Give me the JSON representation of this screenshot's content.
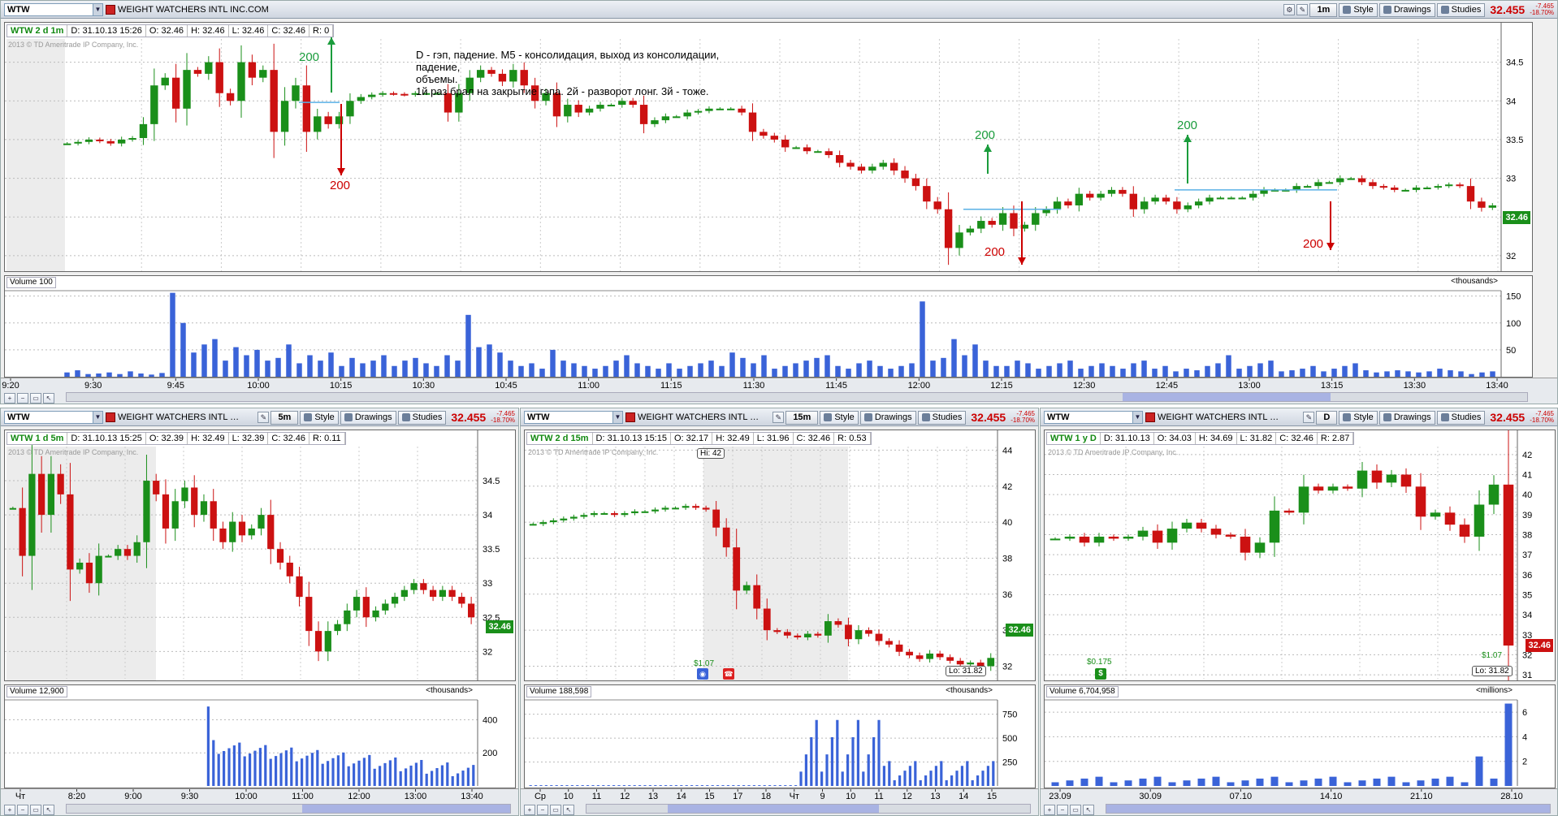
{
  "colors": {
    "up": "#1a8f1a",
    "down": "#cc1111",
    "volume": "#3a63d8",
    "price_tag": "#1a8f1a",
    "last": "#cc0000",
    "ann_green": "#1a9c3c",
    "ann_red": "#cc0000",
    "level_line": "#5ab0e6"
  },
  "top": {
    "symbol": "WTW",
    "company": "WEIGHT WATCHERS INTL INC.COM",
    "aggregation": "1m",
    "style_label": "Style",
    "drawings_label": "Drawings",
    "studies_label": "Studies",
    "last": "32.455",
    "change": "-7.465",
    "change_pct": "-18.70%",
    "info": {
      "ticker": "WTW 2 d 1m",
      "date": "D: 31.10.13 15:26",
      "open": "O: 32.46",
      "high": "H: 32.46",
      "low": "L: 32.46",
      "close": "C: 32.46",
      "range": "R: 0"
    },
    "copyright": "2013 © TD Ameritrade IP Company, Inc.",
    "annotation": [
      "D - гэп, падение. M5 - консолидация, выход из консолидации,",
      "падение,",
      "объемы.",
      "1й раз брал на закрытие гэпа. 2й - разворот лонг. 3й - тоже."
    ],
    "marker_label": "200",
    "price_tag": "32.46",
    "volume_label": "Volume",
    "volume_value": "100",
    "volume_unit": "<thousands>"
  },
  "bl": {
    "symbol": "WTW",
    "company": "WEIGHT WATCHERS INTL I...",
    "aggregation": "5m",
    "style_label": "Style",
    "drawings_label": "Drawings",
    "studies_label": "Studies",
    "last": "32.455",
    "change": "-7.465",
    "change_pct": "-18.70%",
    "info": {
      "ticker": "WTW 1 d 5m",
      "date": "D: 31.10.13 15:25",
      "open": "O: 32.39",
      "high": "H: 32.49",
      "low": "L: 32.39",
      "close": "C: 32.46",
      "range": "R: 0.11"
    },
    "copyright": "2013 © TD Ameritrade IP Company, Inc.",
    "price_tag": "32.46",
    "volume_label": "Volume",
    "volume_value": "12,900",
    "volume_unit": "<thousands>"
  },
  "bm": {
    "symbol": "WTW",
    "company": "WEIGHT WATCHERS INTL I...",
    "aggregation": "15m",
    "style_label": "Style",
    "drawings_label": "Drawings",
    "studies_label": "Studies",
    "last": "32.455",
    "change": "-7.465",
    "change_pct": "-18.70%",
    "info": {
      "ticker": "WTW 2 d 15m",
      "date": "D: 31.10.13 15:15",
      "open": "O: 32.17",
      "high": "H: 32.49",
      "low": "L: 31.96",
      "close": "C: 32.46",
      "range": "R: 0.53"
    },
    "copyright": "2013 © TD Ameritrade IP Company, Inc.",
    "hi_flag": "Hi: 42",
    "lo_flag": "Lo: 31.82",
    "dividend": "$1.07",
    "price_tag": "32.46",
    "volume_label": "Volume",
    "volume_value": "188,598",
    "volume_unit": "<thousands>"
  },
  "br": {
    "symbol": "WTW",
    "company": "WEIGHT WATCHERS INTL I...",
    "aggregation": "D",
    "style_label": "Style",
    "drawings_label": "Drawings",
    "studies_label": "Studies",
    "last": "32.455",
    "change": "-7.465",
    "change_pct": "-18.70%",
    "info": {
      "ticker": "WTW 1 y D",
      "date": "D: 31.10.13",
      "open": "O: 34.03",
      "high": "H: 34.69",
      "low": "L: 31.82",
      "close": "C: 32.46",
      "range": "R: 2.87"
    },
    "copyright": "2013 © TD Ameritrade IP Company, Inc.",
    "lo_flag": "Lo: 31.82",
    "dividend": "$1.07",
    "dividend2": "$0.175",
    "price_tag": "32.46",
    "volume_label": "Volume",
    "volume_value": "6,704,958",
    "volume_unit": "<millions>"
  },
  "chart_data": [
    {
      "id": "top",
      "type": "candlestick",
      "ylim": [
        31.8,
        34.8
      ],
      "yticks": [
        32,
        32.5,
        33,
        33.5,
        34,
        34.5
      ],
      "ytick_labels": [
        "32",
        "32.5",
        "33",
        "33.5",
        "34",
        "34.5"
      ],
      "xtick_labels": [
        "9:20",
        "9:30",
        "9:45",
        "10:00",
        "10:15",
        "10:30",
        "10:45",
        "11:00",
        "11:15",
        "11:30",
        "11:45",
        "12:00",
        "12:15",
        "12:30",
        "12:45",
        "13:00",
        "13:15",
        "13:30",
        "13:40"
      ],
      "close_path": [
        33.45,
        33.47,
        33.5,
        33.48,
        33.45,
        33.5,
        33.52,
        33.7,
        34.2,
        34.3,
        33.9,
        34.4,
        34.35,
        34.5,
        34.1,
        34.0,
        34.5,
        34.3,
        34.4,
        33.6,
        34.0,
        34.2,
        33.6,
        33.8,
        33.7,
        33.8,
        34.0,
        34.05,
        34.08,
        34.1,
        34.09,
        34.08,
        34.1,
        34.1,
        34.1,
        33.85,
        34.1,
        34.3,
        34.4,
        34.35,
        34.25,
        34.4,
        34.2,
        34.0,
        34.1,
        33.8,
        33.95,
        33.85,
        33.9,
        33.95,
        33.95,
        34.0,
        33.95,
        33.7,
        33.75,
        33.8,
        33.8,
        33.85,
        33.87,
        33.9,
        33.9,
        33.9,
        33.85,
        33.6,
        33.55,
        33.5,
        33.4,
        33.4,
        33.35,
        33.35,
        33.3,
        33.2,
        33.15,
        33.1,
        33.15,
        33.2,
        33.1,
        33.0,
        32.9,
        32.7,
        32.6,
        32.1,
        32.3,
        32.35,
        32.45,
        32.4,
        32.55,
        32.35,
        32.4,
        32.55,
        32.6,
        32.7,
        32.65,
        32.8,
        32.75,
        32.8,
        32.85,
        32.8,
        32.6,
        32.7,
        32.75,
        32.7,
        32.6,
        32.65,
        32.7,
        32.75,
        32.75,
        32.75,
        32.75,
        32.8,
        32.85,
        32.85,
        32.85,
        32.9,
        32.9,
        32.95,
        32.95,
        33.0,
        33.0,
        32.95,
        32.9,
        32.88,
        32.85,
        32.85,
        32.88,
        32.88,
        32.9,
        32.92,
        32.9,
        32.7,
        32.62,
        32.65
      ],
      "volume": {
        "ylim": [
          0,
          160
        ],
        "yticks": [
          50,
          100,
          150
        ],
        "ytick_labels": [
          "50",
          "100",
          "150"
        ],
        "values": [
          8,
          12,
          5,
          6,
          8,
          5,
          10,
          6,
          4,
          7,
          156,
          100,
          45,
          60,
          70,
          30,
          55,
          40,
          50,
          30,
          35,
          60,
          25,
          40,
          30,
          45,
          20,
          35,
          25,
          30,
          40,
          20,
          30,
          35,
          25,
          20,
          40,
          30,
          115,
          55,
          60,
          45,
          30,
          20,
          25,
          15,
          50,
          30,
          25,
          20,
          15,
          20,
          30,
          40,
          25,
          20,
          15,
          25,
          15,
          20,
          25,
          30,
          20,
          45,
          35,
          25,
          40,
          15,
          20,
          25,
          30,
          35,
          40,
          20,
          15,
          25,
          30,
          20,
          15,
          20,
          25,
          140,
          30,
          35,
          70,
          40,
          60,
          30,
          20,
          20,
          30,
          25,
          15,
          20,
          25,
          30,
          15,
          20,
          25,
          20,
          15,
          25,
          30,
          15,
          20,
          10,
          15,
          12,
          20,
          25,
          40,
          15,
          20,
          25,
          30,
          10,
          12,
          15,
          20,
          10,
          15,
          20,
          25,
          12,
          8,
          10,
          12,
          10,
          8,
          10,
          15,
          12,
          10,
          5,
          8,
          10
        ]
      }
    },
    {
      "id": "bl",
      "type": "candlestick",
      "ylim": [
        31.6,
        35.0
      ],
      "yticks": [
        32,
        32.5,
        33,
        33.5,
        34,
        34.5
      ],
      "ytick_labels": [
        "32",
        "32.5",
        "33",
        "33.5",
        "34",
        "34.5"
      ],
      "xtick_labels": [
        "Чт",
        "8:20",
        "9:00",
        "9:30",
        "10:00",
        "11:00",
        "12:00",
        "13:00",
        "13:40"
      ],
      "close_path": [
        34.1,
        33.4,
        34.6,
        34.0,
        34.6,
        34.3,
        33.2,
        33.3,
        33.0,
        33.4,
        33.4,
        33.5,
        33.4,
        33.6,
        34.5,
        34.3,
        33.8,
        34.2,
        34.4,
        34.0,
        34.2,
        33.8,
        33.6,
        33.9,
        33.7,
        33.8,
        34.0,
        33.5,
        33.3,
        33.1,
        32.8,
        32.3,
        32.0,
        32.3,
        32.4,
        32.6,
        32.8,
        32.5,
        32.6,
        32.7,
        32.8,
        32.9,
        33.0,
        32.9,
        32.8,
        32.9,
        32.8,
        32.7,
        32.5
      ]
    },
    {
      "id": "bm",
      "type": "candlestick",
      "ylim": [
        31.3,
        44.2
      ],
      "yticks": [
        32,
        34,
        36,
        38,
        40,
        42,
        44
      ],
      "ytick_labels": [
        "32",
        "34",
        "36",
        "38",
        "40",
        "42",
        "44"
      ],
      "xtick_labels": [
        "Ср",
        "10",
        "11",
        "12",
        "13",
        "14",
        "15",
        "17",
        "18",
        "Чт",
        "9",
        "10",
        "11",
        "12",
        "13",
        "14",
        "15"
      ],
      "close_path": [
        39.9,
        40.0,
        40.1,
        40.2,
        40.3,
        40.4,
        40.5,
        40.5,
        40.4,
        40.5,
        40.6,
        40.6,
        40.7,
        40.8,
        40.8,
        40.9,
        40.8,
        40.7,
        39.7,
        38.6,
        36.2,
        36.5,
        35.2,
        34.0,
        33.9,
        33.7,
        33.6,
        33.8,
        33.7,
        34.5,
        34.3,
        33.5,
        34.0,
        33.8,
        33.4,
        33.2,
        32.8,
        32.6,
        32.4,
        32.7,
        32.5,
        32.3,
        32.1,
        32.2,
        32.0,
        32.46
      ],
      "volume": {
        "ylim": [
          0,
          900
        ],
        "yticks": [
          250,
          500,
          750
        ],
        "ytick_labels": [
          "250",
          "500",
          "750"
        ]
      }
    },
    {
      "id": "br",
      "type": "candlestick",
      "ylim": [
        30.8,
        42.4
      ],
      "yticks": [
        31,
        32,
        33,
        34,
        35,
        36,
        37,
        38,
        39,
        40,
        41,
        42
      ],
      "ytick_labels": [
        "31",
        "32",
        "33",
        "34",
        "35",
        "36",
        "37",
        "38",
        "39",
        "40",
        "41",
        "42"
      ],
      "xtick_labels": [
        "23.09",
        "30.09",
        "07.10",
        "14.10",
        "21.10",
        "28.10"
      ],
      "close_path": [
        37.8,
        37.9,
        37.6,
        37.9,
        37.8,
        37.9,
        38.2,
        37.6,
        38.3,
        38.6,
        38.3,
        38.0,
        37.9,
        37.1,
        37.6,
        39.2,
        39.1,
        40.4,
        40.2,
        40.4,
        40.3,
        41.2,
        40.6,
        41.0,
        40.4,
        38.9,
        39.1,
        38.5,
        37.9,
        39.5,
        40.5,
        32.46
      ],
      "volume": {
        "ylim": [
          0,
          7
        ],
        "yticks": [
          2,
          4,
          6
        ],
        "ytick_labels": [
          "2",
          "4",
          "6"
        ]
      }
    }
  ]
}
